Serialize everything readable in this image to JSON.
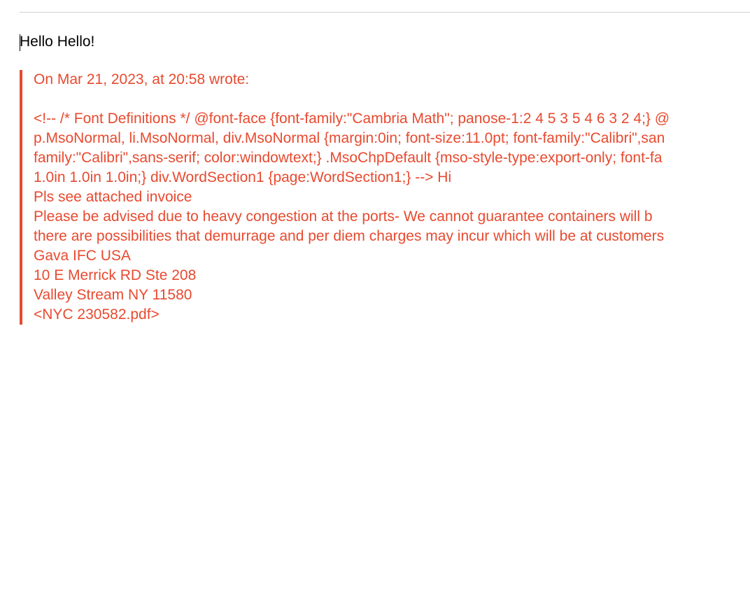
{
  "greeting": "Hello Hello!",
  "quote": {
    "header": "On Mar 21, 2023, at 20:58 wrote:",
    "lines": [
      "<!-- /* Font Definitions */ @font-face {font-family:\"Cambria Math\"; panose-1:2 4 5 3 5 4 6 3 2 4;} @",
      "p.MsoNormal, li.MsoNormal, div.MsoNormal {margin:0in; font-size:11.0pt; font-family:\"Calibri\",san",
      "family:\"Calibri\",sans-serif; color:windowtext;} .MsoChpDefault {mso-style-type:export-only; font-fa",
      "1.0in 1.0in 1.0in;} div.WordSection1 {page:WordSection1;} --> Hi",
      " Pls see  attached  invoice",
      "  Please be advised due to heavy congestion at the ports- We cannot guarantee containers will b",
      "there are possibilities that demurrage and per diem charges may incur which will be at customers",
      " Gava IFC USA",
      "10 E Merrick RD Ste 208",
      "Valley Stream NY 11580",
      "   <NYC 230582.pdf>"
    ]
  }
}
